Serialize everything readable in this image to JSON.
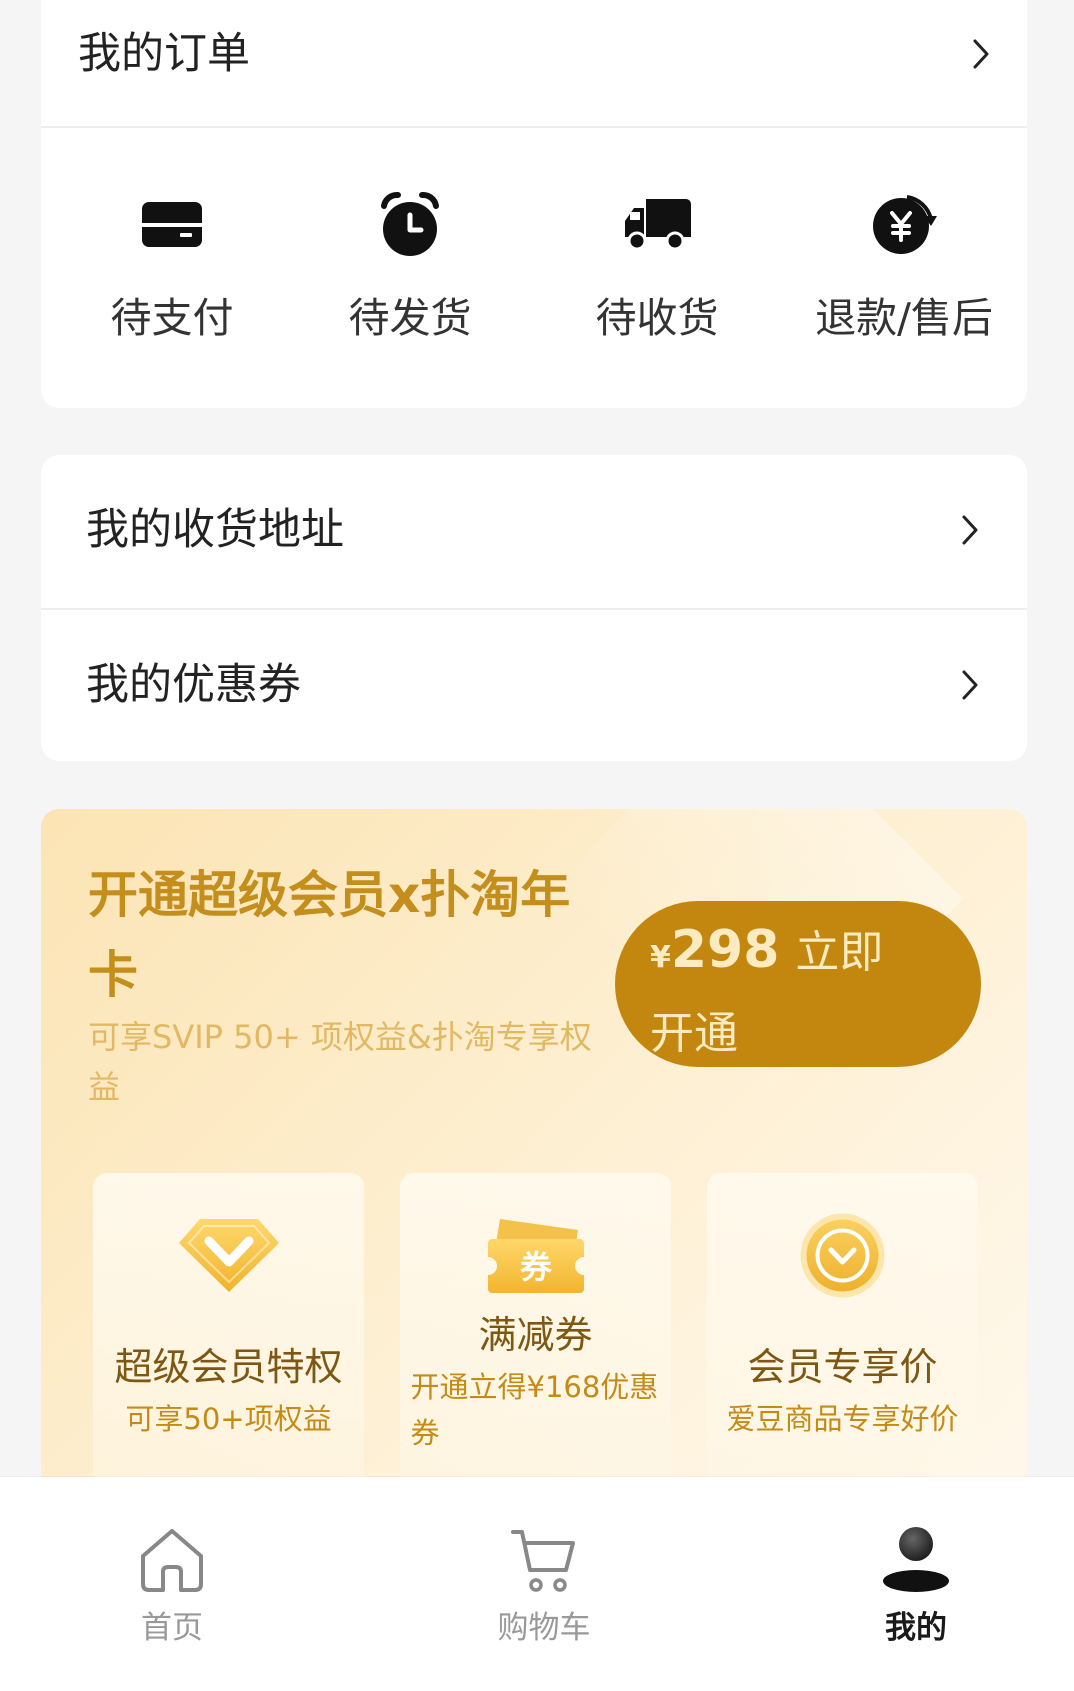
{
  "orders": {
    "title": "我的订单",
    "items": [
      {
        "label": "待支付",
        "icon": "card-icon"
      },
      {
        "label": "待发货",
        "icon": "alarm-clock-icon"
      },
      {
        "label": "待收货",
        "icon": "truck-icon"
      },
      {
        "label": "退款/售后",
        "icon": "refund-yen-icon"
      }
    ]
  },
  "menu": [
    {
      "label": "我的收货地址",
      "icon": "chevron-right-icon"
    },
    {
      "label": "我的优惠券",
      "icon": "chevron-right-icon"
    }
  ],
  "vip": {
    "title": "开通超级会员x扑淘年卡",
    "subtitle": "可享SVIP 50+ 项权益&扑淘专享权益",
    "button": {
      "currency": "¥",
      "price": "298",
      "label": "立即开通"
    },
    "benefits": [
      {
        "title": "超级会员特权",
        "subtitle": "可享50+项权益",
        "icon": "diamond-icon"
      },
      {
        "title": "满减券",
        "subtitle": "开通立得¥168优惠券",
        "icon": "coupon-icon",
        "icon_text": "券"
      },
      {
        "title": "会员专享价",
        "subtitle": "爱豆商品专享好价",
        "icon": "price-badge-icon"
      }
    ]
  },
  "tabbar": {
    "items": [
      {
        "label": "首页",
        "icon": "home-icon",
        "active": false
      },
      {
        "label": "购物车",
        "icon": "cart-icon",
        "active": false
      },
      {
        "label": "我的",
        "icon": "profile-icon",
        "active": true
      }
    ]
  },
  "colors": {
    "page_background": "#F5F5F5",
    "text_primary": "#222222",
    "vip_title": "#C38E1C",
    "vip_subtitle": "#E2B862",
    "vip_button": "#C3870F",
    "vip_button_text": "#FCEBC0",
    "benefit_title": "#7E5713",
    "benefit_subtitle": "#C48B17",
    "tab_inactive": "#999999",
    "tab_active": "#1A1A1A"
  }
}
